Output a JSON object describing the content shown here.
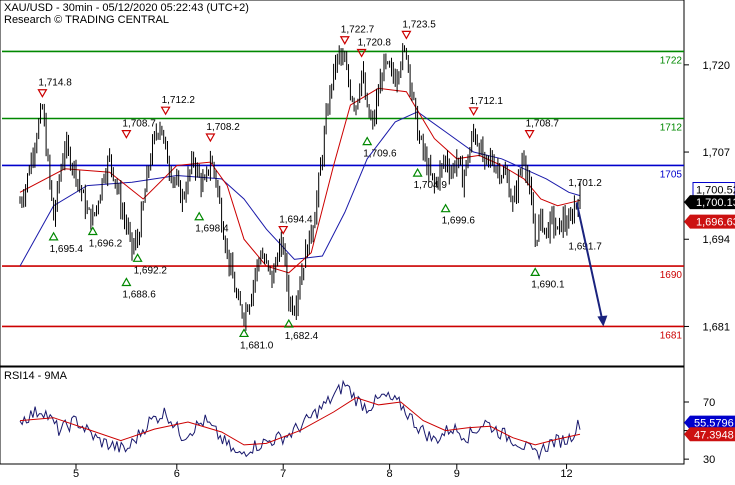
{
  "header": {
    "title": "XAU/USD - 30min - 05/12/2020 05:22:43 (UTC+2)",
    "subtitle": "Research © TRADING CENTRAL"
  },
  "colors": {
    "price": "#000000",
    "ma_fast": "#cc0000",
    "ma_slow": "#1a1aaa",
    "resistance": "#008800",
    "pivot": "#0000cc",
    "support": "#cc0000",
    "rsi": "#1a1a6e",
    "rsi_ma": "#cc0000",
    "bull_marker": "#008800",
    "bear_marker": "#cc0000",
    "price_badge_dark": "#000000",
    "price_badge_blue": "#0000cc",
    "price_badge_red": "#cc1111"
  },
  "chart_data": [
    {
      "type": "line",
      "name": "price-panel",
      "x_tick_labels": [
        "5",
        "6",
        "7",
        "8",
        "9",
        "12"
      ],
      "y_ticks": [
        1681,
        1694,
        1707,
        1720
      ],
      "y_tick_labels": [
        "1,681",
        "1,694",
        "1,707",
        "1,720"
      ],
      "ylim": [
        1675.7,
        1724.3
      ],
      "grid": false,
      "key_levels": [
        {
          "value": 1722,
          "label": "1722",
          "role": "resistance"
        },
        {
          "value": 1712,
          "label": "1712",
          "role": "resistance"
        },
        {
          "value": 1705,
          "label": "1705",
          "role": "pivot"
        },
        {
          "value": 1690,
          "label": "1690",
          "role": "support"
        },
        {
          "value": 1681,
          "label": "1681",
          "role": "support"
        }
      ],
      "price_badges": [
        {
          "value": 1700.52,
          "label": "1,700.52",
          "style": "blue"
        },
        {
          "value": 1700.13,
          "label": "1,700.13",
          "style": "dark"
        },
        {
          "value": 1696.63,
          "label": "1,696.63",
          "style": "red"
        }
      ],
      "swing_labels": [
        {
          "x": 0.2,
          "y": 1714.8,
          "label": "1,714.8",
          "type": "high"
        },
        {
          "x": 0.3,
          "y": 1695.4,
          "label": "1,695.4",
          "type": "low"
        },
        {
          "x": 0.65,
          "y": 1696.2,
          "label": "1,696.2",
          "type": "low"
        },
        {
          "x": 0.95,
          "y": 1708.7,
          "label": "1,708.7",
          "type": "high"
        },
        {
          "x": 0.95,
          "y": 1688.6,
          "label": "1,688.6",
          "type": "low"
        },
        {
          "x": 1.05,
          "y": 1692.2,
          "label": "1,692.2",
          "type": "low"
        },
        {
          "x": 1.3,
          "y": 1712.2,
          "label": "1,712.2",
          "type": "high"
        },
        {
          "x": 1.6,
          "y": 1698.4,
          "label": "1,698.4",
          "type": "low"
        },
        {
          "x": 1.7,
          "y": 1708.2,
          "label": "1,708.2",
          "type": "high"
        },
        {
          "x": 2.0,
          "y": 1681.0,
          "label": "1,681.0",
          "type": "low"
        },
        {
          "x": 2.35,
          "y": 1694.4,
          "label": "1,694.4",
          "type": "high"
        },
        {
          "x": 2.4,
          "y": 1682.4,
          "label": "1,682.4",
          "type": "low"
        },
        {
          "x": 2.9,
          "y": 1722.7,
          "label": "1,722.7",
          "type": "high"
        },
        {
          "x": 3.05,
          "y": 1720.8,
          "label": "1,720.8",
          "type": "high"
        },
        {
          "x": 3.1,
          "y": 1709.6,
          "label": "1,709.6",
          "type": "low"
        },
        {
          "x": 3.45,
          "y": 1723.5,
          "label": "1,723.5",
          "type": "high"
        },
        {
          "x": 3.55,
          "y": 1704.9,
          "label": "1,704.9",
          "type": "low"
        },
        {
          "x": 3.8,
          "y": 1699.6,
          "label": "1,699.6",
          "type": "low"
        },
        {
          "x": 4.05,
          "y": 1712.1,
          "label": "1,712.1",
          "type": "high"
        },
        {
          "x": 4.55,
          "y": 1708.7,
          "label": "1,708.7",
          "type": "high"
        },
        {
          "x": 4.6,
          "y": 1690.1,
          "label": "1,690.1",
          "type": "low"
        },
        {
          "x": 4.95,
          "y": 1701.2,
          "label": "1,701.2",
          "type": "level"
        },
        {
          "x": 4.95,
          "y": 1691.7,
          "label": "1,691.7",
          "type": "level"
        }
      ],
      "series": [
        {
          "x": [
            0,
            0.05,
            0.1,
            0.15,
            0.2,
            0.25,
            0.3,
            0.35,
            0.4,
            0.45,
            0.5,
            0.55,
            0.6,
            0.65,
            0.7,
            0.75,
            0.8,
            0.85,
            0.9,
            0.95,
            1.0,
            1.05,
            1.1,
            1.15,
            1.2,
            1.25,
            1.3,
            1.35,
            1.4,
            1.45,
            1.5,
            1.55,
            1.6,
            1.65,
            1.7,
            1.75,
            1.8,
            1.85,
            1.9,
            1.95,
            2.0,
            2.05,
            2.1,
            2.15,
            2.2,
            2.25,
            2.3,
            2.35,
            2.4,
            2.45,
            2.5,
            2.55,
            2.6,
            2.65,
            2.7,
            2.75,
            2.8,
            2.85,
            2.9,
            2.95,
            3.0,
            3.05,
            3.1,
            3.15,
            3.2,
            3.25,
            3.3,
            3.35,
            3.4,
            3.45,
            3.5,
            3.55,
            3.6,
            3.65,
            3.7,
            3.75,
            3.8,
            3.85,
            3.9,
            3.95,
            4.0,
            4.05,
            4.1,
            4.15,
            4.2,
            4.25,
            4.3,
            4.35,
            4.4,
            4.45,
            4.5,
            4.55,
            4.6,
            4.65,
            4.7,
            4.75,
            4.8,
            4.85,
            4.9,
            4.95,
            5.0
          ],
          "y": [
            1699.5,
            1702,
            1706,
            1710,
            1713.5,
            1705,
            1697,
            1703,
            1708,
            1706,
            1704,
            1701,
            1698,
            1697,
            1700,
            1704,
            1706,
            1703,
            1699,
            1696,
            1692.5,
            1694,
            1699,
            1705,
            1709,
            1711.5,
            1707,
            1704,
            1702,
            1700,
            1703,
            1706,
            1703,
            1702,
            1706,
            1703,
            1697,
            1692,
            1688,
            1684,
            1683,
            1685,
            1689,
            1692,
            1690,
            1688,
            1692,
            1693,
            1685,
            1684,
            1688,
            1692,
            1695,
            1700,
            1707,
            1714,
            1719,
            1721.5,
            1720,
            1716,
            1714,
            1719,
            1713,
            1711,
            1716,
            1720,
            1719,
            1718,
            1721,
            1722,
            1716,
            1710,
            1707,
            1704,
            1702,
            1704,
            1706,
            1704,
            1706,
            1703,
            1706,
            1710,
            1708,
            1705,
            1706,
            1705,
            1704,
            1703,
            1699,
            1703,
            1707,
            1701,
            1694,
            1697,
            1695,
            1697,
            1695,
            1697,
            1696,
            1699,
            1700.3
          ],
          "noise": 1.6
        }
      ],
      "ma_fast": {
        "x": [
          0,
          0.4,
          0.8,
          1.1,
          1.4,
          1.7,
          1.85,
          2.0,
          2.2,
          2.4,
          2.6,
          2.8,
          2.95,
          3.2,
          3.45,
          3.7,
          3.9,
          4.1,
          4.3,
          4.5,
          4.65,
          4.8,
          4.95,
          5.0
        ],
        "y": [
          1701,
          1704.5,
          1704,
          1700,
          1705,
          1705.5,
          1702,
          1694,
          1690,
          1689,
          1692,
          1705,
          1714,
          1716.5,
          1716,
          1709,
          1706,
          1706.5,
          1705,
          1703,
          1700,
          1699,
          1699.6,
          1699.8
        ]
      },
      "ma_slow": {
        "x": [
          0,
          0.3,
          0.6,
          1.0,
          1.4,
          1.8,
          2.0,
          2.2,
          2.45,
          2.7,
          2.9,
          3.1,
          3.35,
          3.55,
          3.8,
          4.05,
          4.3,
          4.5,
          4.7,
          4.9,
          5.0
        ],
        "y": [
          1690,
          1699,
          1702,
          1702.5,
          1703.5,
          1703,
          1700,
          1695.5,
          1691,
          1691.5,
          1698,
          1706,
          1711.5,
          1713,
          1710,
          1707,
          1706,
          1704.5,
          1703,
          1701,
          1700.5
        ]
      },
      "forecast_arrow": {
        "from": {
          "x": 4.97,
          "y": 1699.5
        },
        "to": {
          "x": 5.2,
          "y": 1681
        }
      }
    },
    {
      "type": "line",
      "name": "rsi-panel",
      "title": "RSI14 - 9MA",
      "y_ticks": [
        30,
        50,
        70
      ],
      "y_tick_labels": [
        "30",
        "50",
        "70"
      ],
      "ylim": [
        28,
        91
      ],
      "grid": false,
      "badges": [
        {
          "value": 55.5796,
          "label": "55.5796",
          "style": "blue"
        },
        {
          "value": 47.3948,
          "label": "47.3948",
          "style": "red"
        }
      ],
      "series": [
        {
          "name": "rsi",
          "x": [
            0,
            0.2,
            0.35,
            0.5,
            0.7,
            0.95,
            1.15,
            1.3,
            1.45,
            1.65,
            1.8,
            1.95,
            2.05,
            2.2,
            2.4,
            2.55,
            2.75,
            2.85,
            2.9,
            3.0,
            3.1,
            3.25,
            3.4,
            3.55,
            3.7,
            3.85,
            4.0,
            4.15,
            4.3,
            4.45,
            4.6,
            4.75,
            4.9,
            4.97,
            5.0
          ],
          "y": [
            57,
            65,
            50,
            57,
            43,
            36,
            56,
            63,
            46,
            57,
            44,
            32,
            38,
            42,
            47,
            56,
            70,
            78,
            83,
            72,
            66,
            74,
            68,
            53,
            43,
            52,
            46,
            56,
            48,
            42,
            33,
            42,
            44,
            52,
            55.6
          ],
          "noise": 5
        },
        {
          "name": "rsi_ma",
          "x": [
            0,
            0.3,
            0.6,
            0.9,
            1.2,
            1.5,
            1.8,
            2.0,
            2.2,
            2.5,
            2.8,
            3.0,
            3.2,
            3.4,
            3.6,
            3.8,
            4.0,
            4.2,
            4.4,
            4.6,
            4.8,
            5.0
          ],
          "y": [
            57,
            59,
            51,
            43,
            51,
            56,
            49,
            40,
            41,
            50,
            63,
            73,
            68,
            70,
            57,
            50,
            52,
            53,
            45,
            40,
            44,
            47.4
          ]
        }
      ]
    }
  ]
}
